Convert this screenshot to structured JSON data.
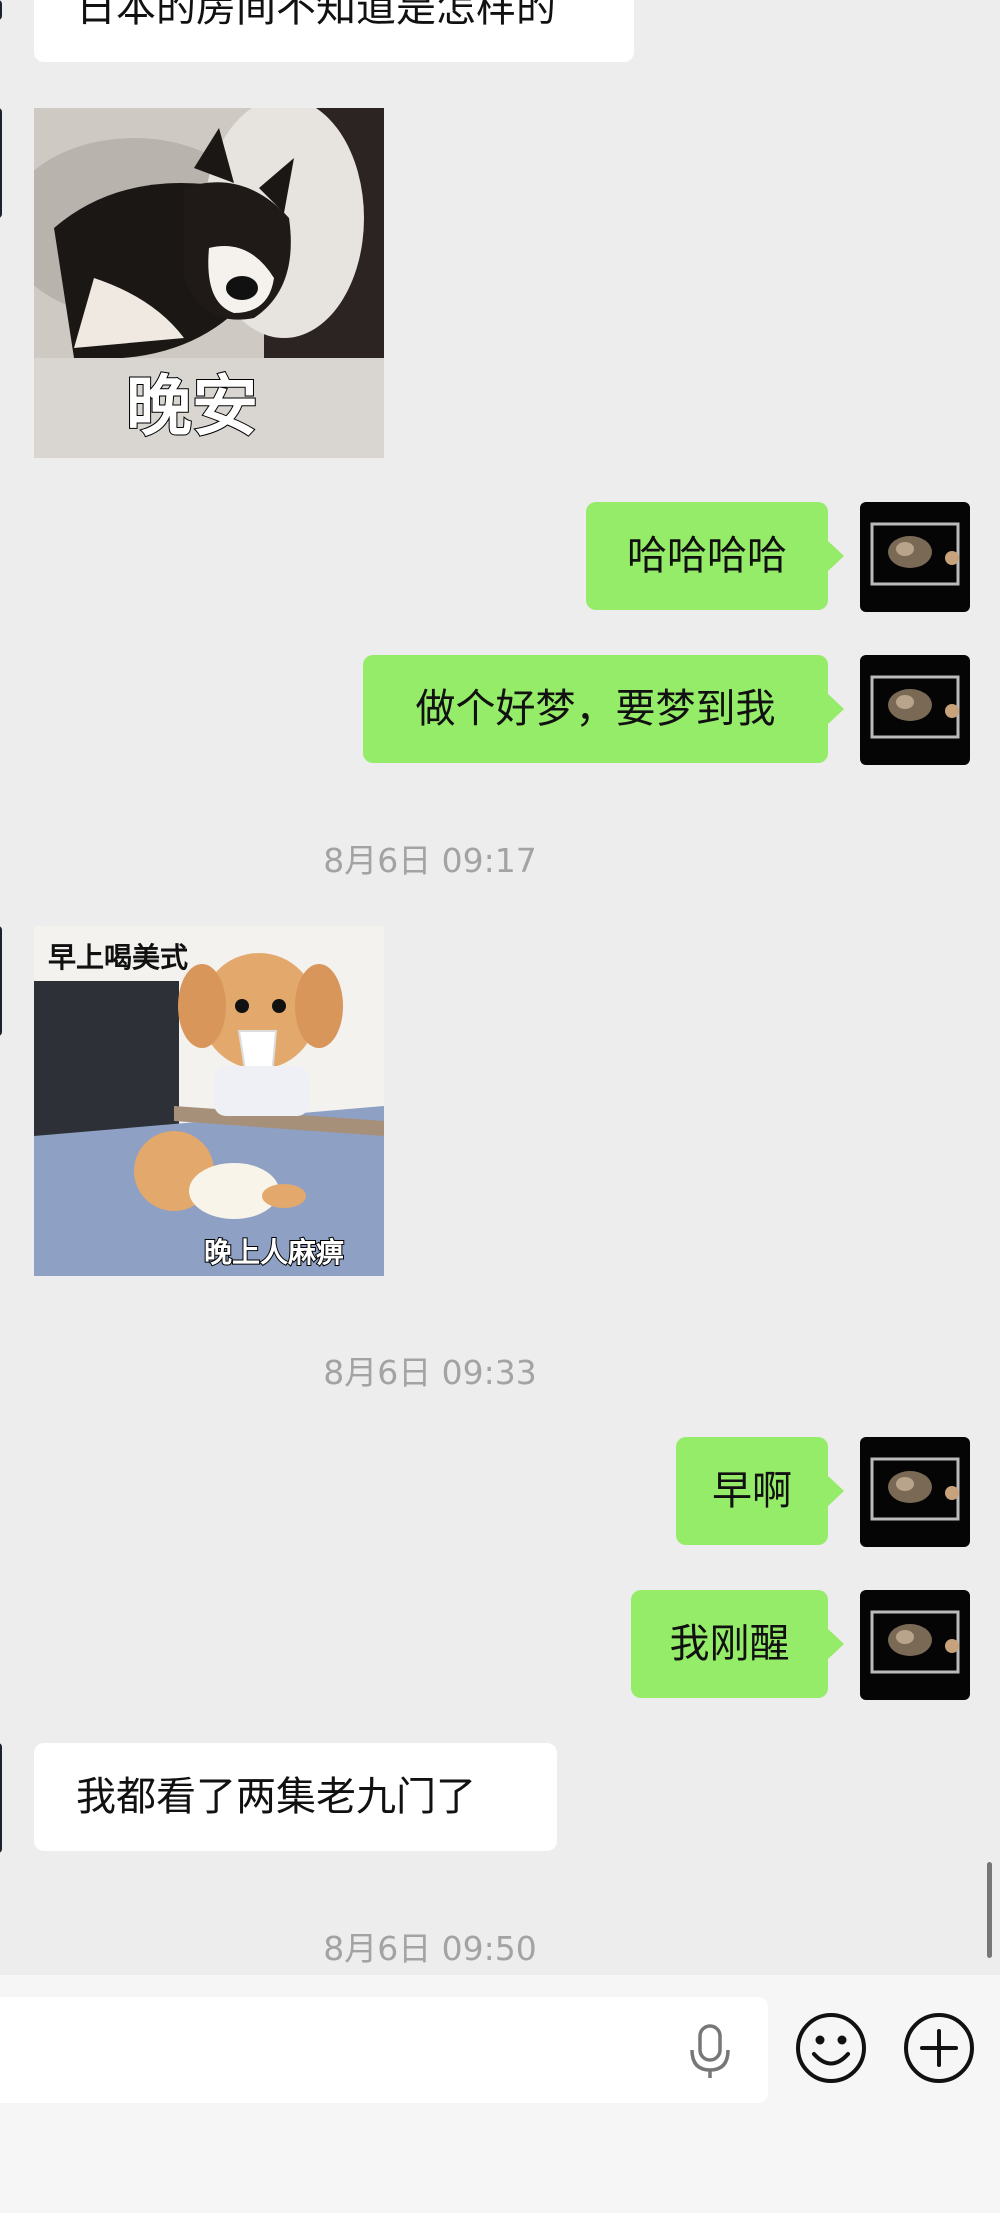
{
  "messages": {
    "m1": "日本的房间不知道是怎样的",
    "m2_sticker_caption": "晚安",
    "m3": "哈哈哈哈",
    "m4": "做个好梦，要梦到我",
    "ts1": "8月6日 09:17",
    "m5_sticker_caption_top": "早上喝美式",
    "m5_sticker_caption_bottom": "晚上人麻痹",
    "ts2": "8月6日 09:33",
    "m6": "早啊",
    "m7": "我刚醒",
    "m8": "我都看了两集老九门了",
    "ts3": "8月6日 09:50"
  },
  "icons": {
    "mic": "microphone-icon",
    "emoji": "smiley-face-icon",
    "add": "plus-circle-icon"
  },
  "colors": {
    "chat_bg": "#ededed",
    "outgoing_bubble": "#95ec69",
    "incoming_bubble": "#ffffff",
    "timestamp_text": "#a3a3a3"
  }
}
